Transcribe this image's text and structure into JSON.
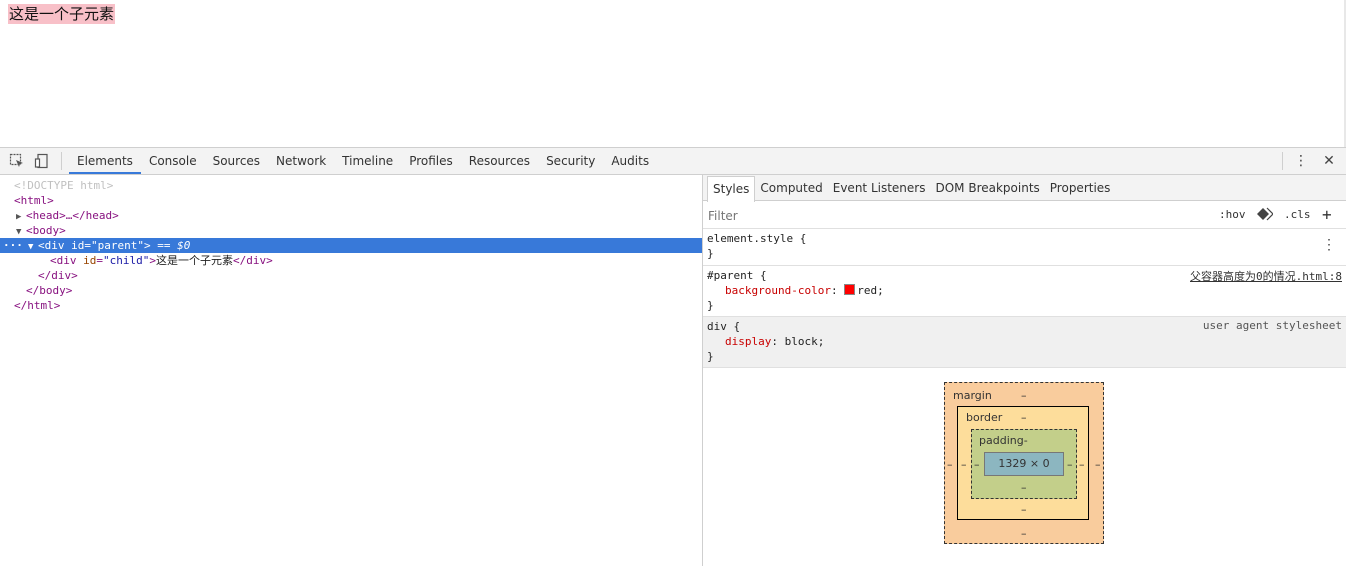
{
  "page": {
    "child_text": "这是一个子元素",
    "child_bg": "#f8c0c8"
  },
  "toolbar": {
    "tabs": [
      "Elements",
      "Console",
      "Sources",
      "Network",
      "Timeline",
      "Profiles",
      "Resources",
      "Security",
      "Audits"
    ],
    "active_tab": "Elements",
    "icons": [
      "inspect-icon",
      "device-mode-icon",
      "more-vertical-icon",
      "close-icon"
    ]
  },
  "dom": {
    "doctype": "<!DOCTYPE html>",
    "html_open": "<html>",
    "head": "<head>…</head>",
    "body_open": "<body>",
    "div_parent_tag": "div",
    "div_parent_attr": "id",
    "div_parent_val": "\"parent\"",
    "selected_marker": "== $0",
    "div_child_tag": "div",
    "div_child_attr": "id",
    "div_child_val": "\"child\"",
    "div_child_text": "这是一个子元素",
    "div_close": "</div>",
    "div_close_inner": "</div>",
    "body_close": "</body>",
    "html_close": "</html>"
  },
  "styles": {
    "subtabs": [
      "Styles",
      "Computed",
      "Event Listeners",
      "DOM Breakpoints",
      "Properties"
    ],
    "filter_placeholder": "Filter",
    "hov": ":hov",
    "cls": ".cls",
    "rules": {
      "element_style": "element.style {",
      "close": "}",
      "parent_selector": "#parent {",
      "parent_prop": "background-color",
      "parent_value": "red;",
      "parent_source": "父容器高度为0的情况.html:8",
      "div_selector": "div {",
      "div_prop": "display",
      "div_value": "block;",
      "div_source": "user agent stylesheet"
    }
  },
  "box_model": {
    "margin_label": "margin",
    "border_label": "border",
    "padding_label": "padding-",
    "content_size": "1329 × 0",
    "dash": "–"
  }
}
